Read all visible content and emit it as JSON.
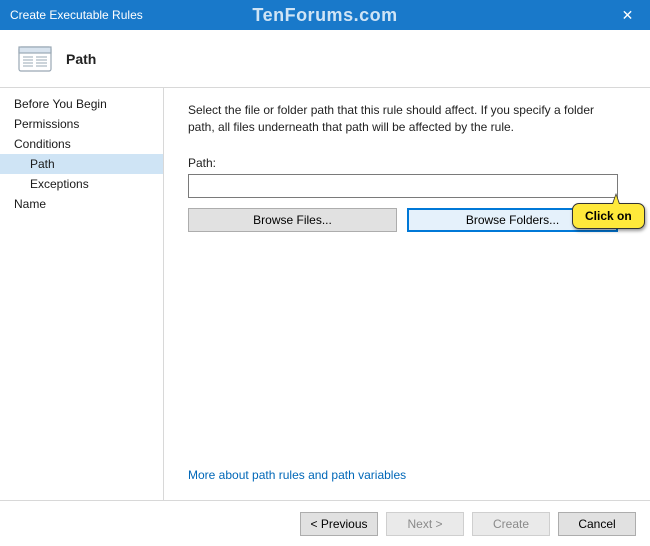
{
  "window": {
    "title": "Create Executable Rules",
    "watermark": "TenForums.com"
  },
  "header": {
    "title": "Path"
  },
  "sidebar": {
    "items": [
      {
        "label": "Before You Begin"
      },
      {
        "label": "Permissions"
      },
      {
        "label": "Conditions"
      },
      {
        "label": "Path"
      },
      {
        "label": "Exceptions"
      },
      {
        "label": "Name"
      }
    ]
  },
  "main": {
    "description": "Select the file or folder path that this rule should affect. If you specify a folder path, all files underneath that path will be affected by the rule.",
    "path_label": "Path:",
    "path_value": "",
    "browse_files_label": "Browse Files...",
    "browse_folders_label": "Browse Folders...",
    "more_link": "More about path rules and path variables"
  },
  "callout": {
    "text": "Click on"
  },
  "footer": {
    "previous": "< Previous",
    "next": "Next >",
    "create": "Create",
    "cancel": "Cancel"
  }
}
